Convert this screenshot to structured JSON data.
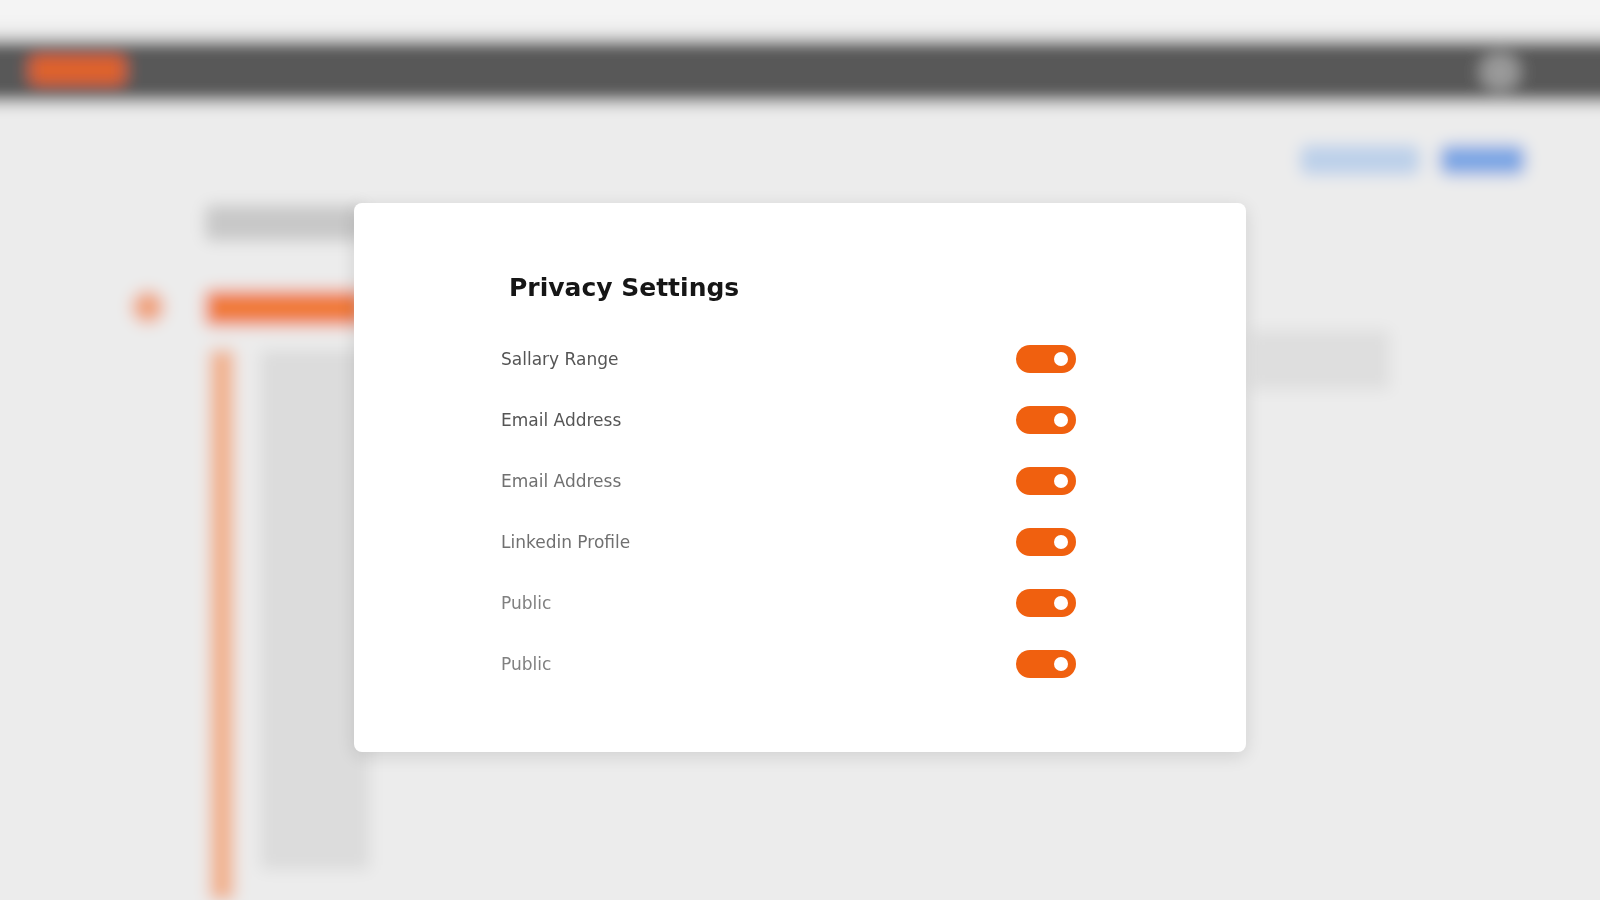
{
  "dialog": {
    "title": "Privacy Settings",
    "settings": [
      {
        "label": "Sallary Range",
        "on": true
      },
      {
        "label": "Email Address",
        "on": true
      },
      {
        "label": "Email Address",
        "on": true
      },
      {
        "label": "Linkedin Profile",
        "on": true
      },
      {
        "label": "Public",
        "on": true
      },
      {
        "label": "Public",
        "on": true
      }
    ]
  }
}
